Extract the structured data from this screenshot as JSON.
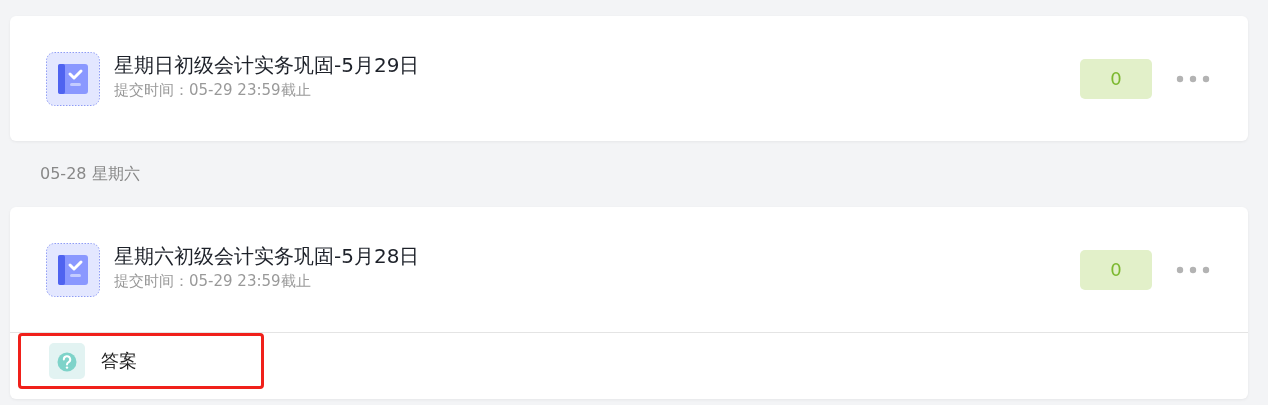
{
  "groups": [
    {
      "tasks": [
        {
          "title": "星期日初级会计实务巩固-5月29日",
          "deadline": "提交时间：05-29 23:59截止",
          "score": "0"
        }
      ]
    },
    {
      "date": "05-28 星期六",
      "tasks": [
        {
          "title": "星期六初级会计实务巩固-5月28日",
          "deadline": "提交时间：05-29 23:59截止",
          "score": "0",
          "attachments": [
            {
              "label": "答案",
              "highlighted": true
            }
          ]
        }
      ]
    }
  ]
}
